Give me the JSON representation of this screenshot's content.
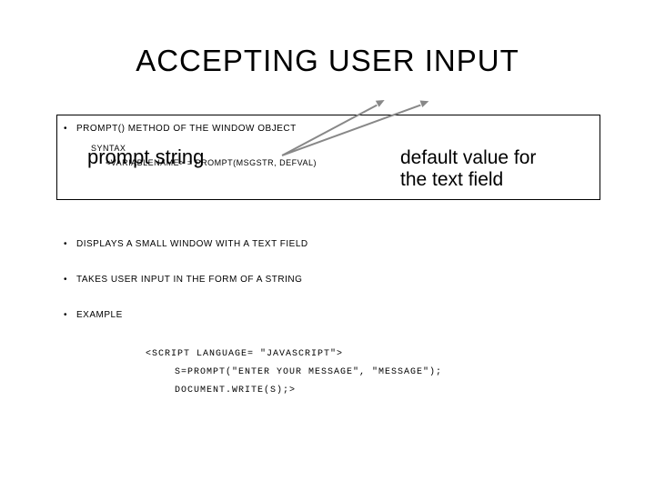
{
  "title": "ACCEPTING USER INPUT",
  "bullets": {
    "b1": "PROMPT() METHOD OF THE WINDOW OBJECT",
    "syntax_label": "SYNTAX",
    "syntax_line": "<VARIABLENAME> = PROMPT(MSGSTR, DEFVAL)",
    "b2": "DISPLAYS A SMALL WINDOW WITH A TEXT FIELD",
    "b3": "TAKES USER INPUT IN THE FORM OF A STRING",
    "b4": "EXAMPLE"
  },
  "overlay": "prompt string",
  "callout": "default value for the text field",
  "code": {
    "l1": "<SCRIPT LANGUAGE= \"JAVASCRIPT\">",
    "l2": "S=PROMPT(\"ENTER YOUR MESSAGE\", \"MESSAGE\");",
    "l3": "DOCUMENT.WRITE(S);>"
  }
}
